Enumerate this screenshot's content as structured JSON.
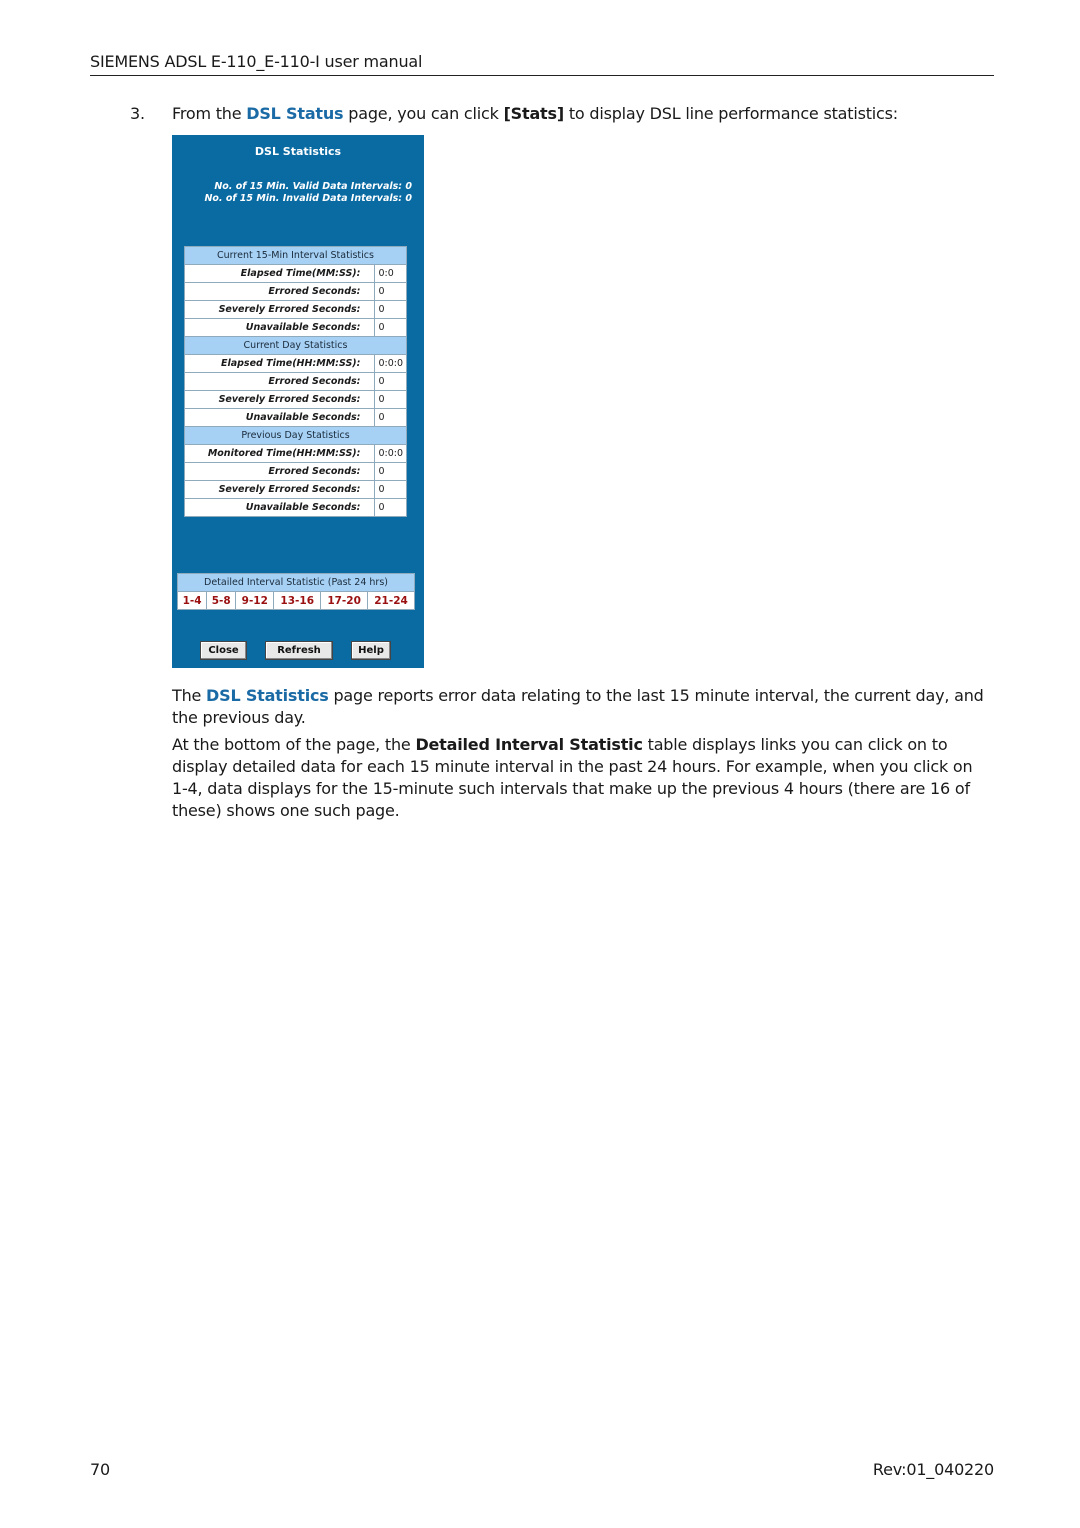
{
  "header": {
    "title": "SIEMENS ADSL E-110_E-110-I user manual"
  },
  "step": {
    "number": "3.",
    "text_before": "From the ",
    "link": "DSL Status",
    "text_mid": " page, you can click ",
    "bold": "[Stats]",
    "text_after": " to display DSL line performance statistics:"
  },
  "panel": {
    "title": "DSL Statistics",
    "valid_intervals": "No. of 15 Min. Valid Data Intervals:  0",
    "invalid_intervals": "No. of 15 Min. Invalid Data Intervals:  0",
    "sections": [
      {
        "heading": "Current 15-Min Interval Statistics",
        "rows": [
          {
            "label": "Elapsed Time(MM:SS):",
            "value": "0:0"
          },
          {
            "label": "Errored Seconds:",
            "value": "0"
          },
          {
            "label": "Severely Errored Seconds:",
            "value": "0"
          },
          {
            "label": "Unavailable Seconds:",
            "value": "0"
          }
        ]
      },
      {
        "heading": "Current Day Statistics",
        "rows": [
          {
            "label": "Elapsed Time(HH:MM:SS):",
            "value": "0:0:0"
          },
          {
            "label": "Errored Seconds:",
            "value": "0"
          },
          {
            "label": "Severely Errored Seconds:",
            "value": "0"
          },
          {
            "label": "Unavailable Seconds:",
            "value": "0"
          }
        ]
      },
      {
        "heading": "Previous Day Statistics",
        "rows": [
          {
            "label": "Monitored Time(HH:MM:SS):",
            "value": "0:0:0"
          },
          {
            "label": "Errored Seconds:",
            "value": "0"
          },
          {
            "label": "Severely Errored Seconds:",
            "value": "0"
          },
          {
            "label": "Unavailable Seconds:",
            "value": "0"
          }
        ]
      }
    ],
    "detail": {
      "heading": "Detailed Interval Statistic (Past 24 hrs)",
      "links": [
        "1-4",
        "5-8",
        "9-12",
        "13-16",
        "17-20",
        "21-24"
      ]
    },
    "buttons": {
      "close": "Close",
      "refresh": "Refresh",
      "help": "Help"
    }
  },
  "para1": {
    "text_before": "The ",
    "link": "DSL Statistics",
    "text_after": " page reports error data relating to the last 15 minute interval, the current day, and the previous day."
  },
  "para2": {
    "text_before": "At the bottom of the page, the ",
    "bold": "Detailed Interval Statistic",
    "text_after": " table displays links you can click on to display detailed data for each 15 minute interval in the past 24 hours. For example, when you click on 1-4, data displays for the 15-minute such intervals that make up the previous 4 hours (there are 16 of these) shows one such page."
  },
  "footer": {
    "page_number": "70",
    "revision": "Rev:01_040220"
  },
  "colors": {
    "link": "#1a6aa6",
    "panel_bg": "#0a6ba3",
    "section_bg": "#a6d1f5",
    "interval_link": "#9a1010"
  }
}
